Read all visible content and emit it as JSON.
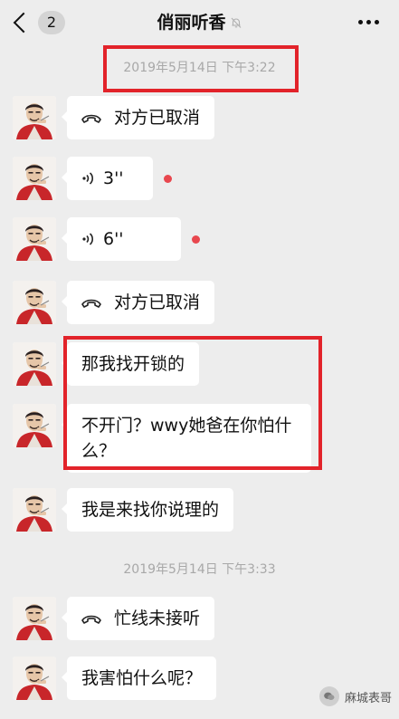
{
  "header": {
    "back_count": "2",
    "title": "俏丽听香",
    "mute_icon": "bell-off-icon",
    "more_icon": "more-dots-icon"
  },
  "colors": {
    "background": "#ededed",
    "bubble": "#ffffff",
    "unread_dot": "#e8474e",
    "highlight": "#e2232a"
  },
  "timestamps": [
    "2019年5月14日 下午3:22",
    "2019年5月14日 下午3:33"
  ],
  "messages": [
    {
      "type": "call",
      "icon": "phone-hangup-icon",
      "text": "对方已取消"
    },
    {
      "type": "voice",
      "icon": "voice-wave-icon",
      "text": "3''",
      "unread": true
    },
    {
      "type": "voice",
      "icon": "voice-wave-icon",
      "text": "6''",
      "unread": true
    },
    {
      "type": "call",
      "icon": "phone-hangup-icon",
      "text": "对方已取消"
    },
    {
      "type": "text",
      "text": "那我找开锁的"
    },
    {
      "type": "text",
      "line1": "不开门？wwy她爸在你怕什",
      "line2": "么？"
    },
    {
      "type": "text",
      "text": "我是来找你说理的"
    },
    {
      "type": "call",
      "icon": "phone-hangup-icon",
      "text": "忙线未接听"
    },
    {
      "type": "text",
      "text": "我害怕什么呢？"
    }
  ],
  "watermark": {
    "text": "麻城表哥",
    "icon": "wechat-channel-icon"
  }
}
